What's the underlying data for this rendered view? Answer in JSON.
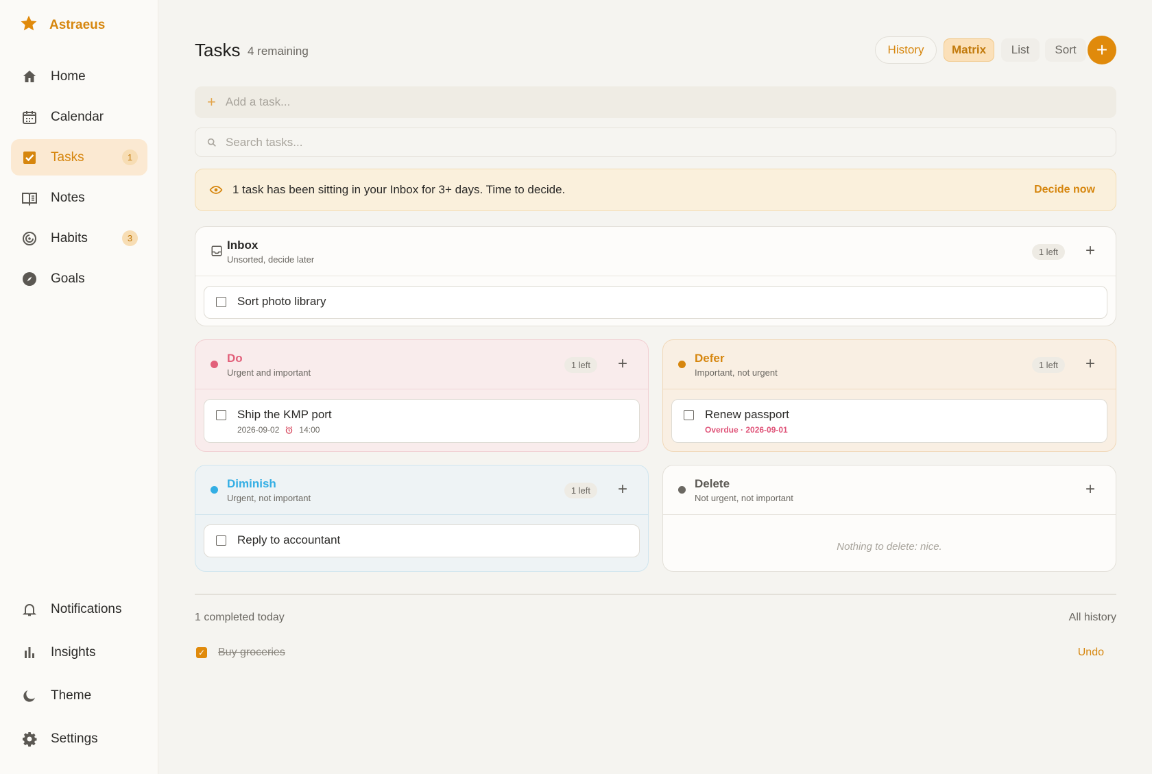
{
  "app": {
    "name": "Astraeus",
    "accent": "#e08a0b"
  },
  "sidebar": {
    "items": [
      {
        "label": "Home",
        "icon": "home-icon"
      },
      {
        "label": "Calendar",
        "icon": "calendar-icon"
      },
      {
        "label": "Tasks",
        "icon": "check-square-icon",
        "badge": "1",
        "active": true
      },
      {
        "label": "Notes",
        "icon": "book-icon"
      },
      {
        "label": "Habits",
        "icon": "target-icon",
        "badge": "3"
      },
      {
        "label": "Goals",
        "icon": "compass-icon"
      }
    ],
    "bottom": [
      {
        "label": "Notifications",
        "icon": "bell-icon"
      },
      {
        "label": "Insights",
        "icon": "bar-chart-icon"
      },
      {
        "label": "Theme",
        "icon": "moon-icon"
      },
      {
        "label": "Settings",
        "icon": "gear-icon"
      }
    ]
  },
  "header": {
    "title": "Tasks",
    "remaining": "4 remaining",
    "history": "History",
    "matrix": "Matrix",
    "list": "List",
    "sort": "Sort",
    "add": "+"
  },
  "add_task": {
    "placeholder": "Add a task..."
  },
  "search": {
    "placeholder": "Search tasks..."
  },
  "banner": {
    "text": "1 task has been sitting in your Inbox for 3+ days. Time to decide.",
    "action": "Decide now"
  },
  "inbox": {
    "title": "Inbox",
    "subtitle": "Unsorted, decide later",
    "count": "1 left",
    "tasks": [
      {
        "name": "Sort photo library"
      }
    ]
  },
  "quadrants": {
    "do": {
      "title": "Do",
      "subtitle": "Urgent and important",
      "count": "1 left",
      "color": "#e2607a",
      "tasks": [
        {
          "name": "Ship the KMP port",
          "date": "2026-09-02",
          "time": "14:00"
        }
      ]
    },
    "defer": {
      "title": "Defer",
      "subtitle": "Important, not urgent",
      "count": "1 left",
      "color": "#d6860e",
      "tasks": [
        {
          "name": "Renew passport",
          "meta": "Overdue · 2026-09-01"
        }
      ]
    },
    "diminish": {
      "title": "Diminish",
      "subtitle": "Urgent, not important",
      "count": "1 left",
      "color": "#33aee4",
      "tasks": [
        {
          "name": "Reply to accountant"
        }
      ]
    },
    "delete": {
      "title": "Delete",
      "subtitle": "Not urgent, not important",
      "color": "#6b6862",
      "empty": "Nothing to delete: nice."
    }
  },
  "footer": {
    "completed": "1 completed today",
    "all_history": "All history",
    "done": [
      {
        "name": "Buy groceries",
        "action": "Undo"
      }
    ]
  }
}
